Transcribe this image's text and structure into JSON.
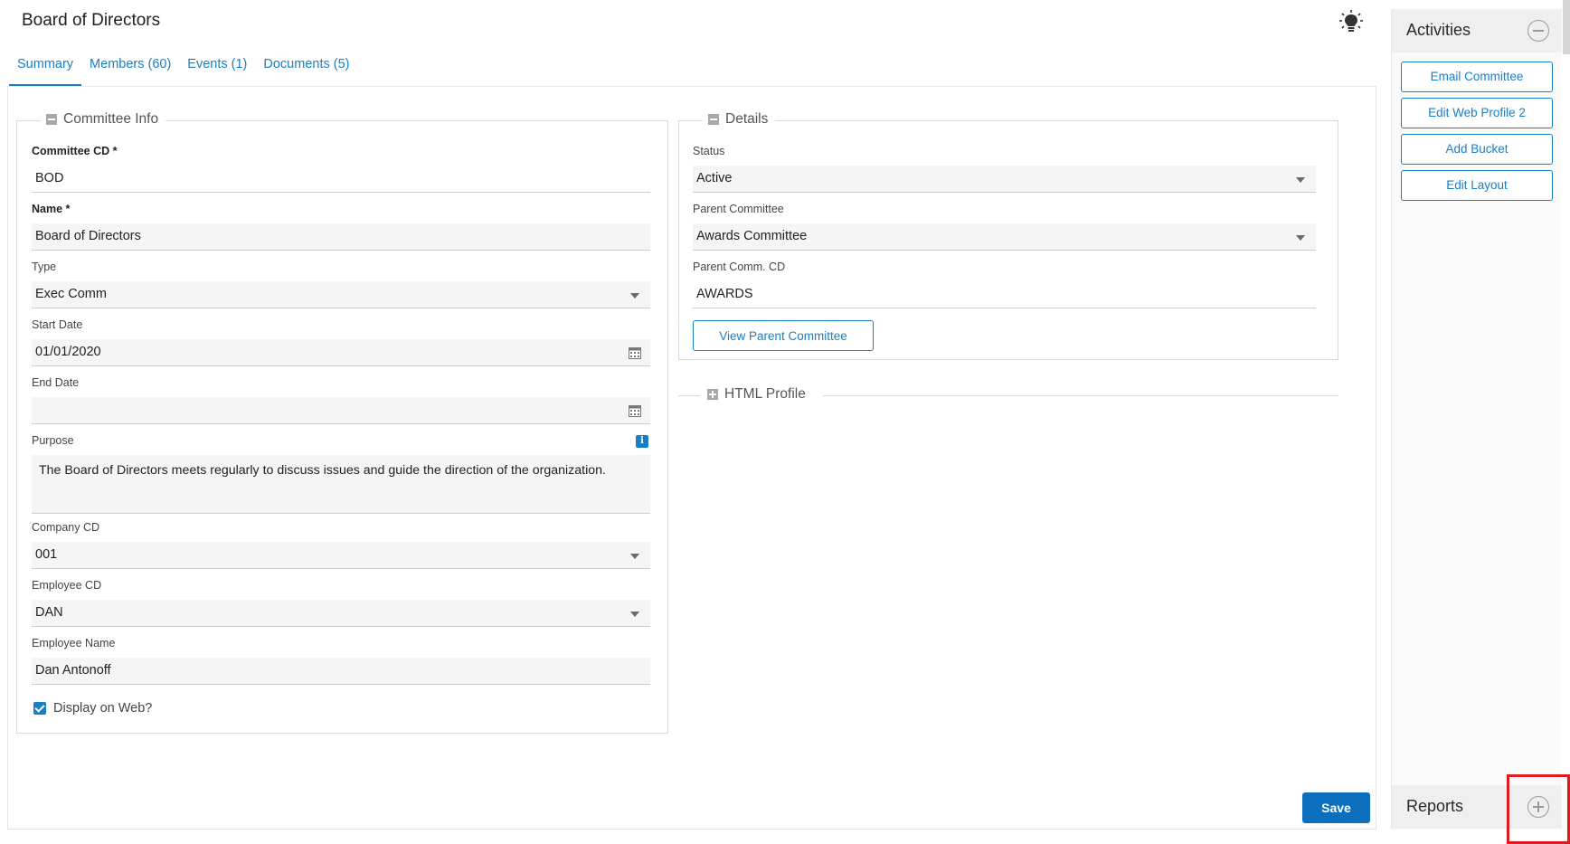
{
  "page": {
    "title": "Board of Directors"
  },
  "tabs": [
    {
      "label": "Summary",
      "active": true
    },
    {
      "label": "Members (60)",
      "active": false
    },
    {
      "label": "Events (1)",
      "active": false
    },
    {
      "label": "Documents (5)",
      "active": false
    }
  ],
  "committee_info": {
    "legend": "Committee Info",
    "committee_cd": {
      "label": "Committee CD *",
      "value": "BOD"
    },
    "name": {
      "label": "Name *",
      "value": "Board of Directors"
    },
    "type": {
      "label": "Type",
      "value": "Exec Comm"
    },
    "start_date": {
      "label": "Start Date",
      "value": "01/01/2020"
    },
    "end_date": {
      "label": "End Date",
      "value": ""
    },
    "purpose": {
      "label": "Purpose",
      "value": "The Board of Directors meets regularly to discuss issues and guide the direction of the organization."
    },
    "company_cd": {
      "label": "Company CD",
      "value": "001"
    },
    "employee_cd": {
      "label": "Employee CD",
      "value": "DAN"
    },
    "employee_name": {
      "label": "Employee Name",
      "value": "Dan Antonoff"
    },
    "display_on_web": {
      "label": "Display on Web?",
      "checked": true
    }
  },
  "details": {
    "legend": "Details",
    "status": {
      "label": "Status",
      "value": "Active"
    },
    "parent_committee": {
      "label": "Parent Committee",
      "value": "Awards Committee"
    },
    "parent_comm_cd": {
      "label": "Parent Comm. CD",
      "value": "AWARDS"
    },
    "view_parent_button": "View Parent Committee"
  },
  "html_profile": {
    "legend": "HTML Profile"
  },
  "save_button": "Save",
  "activities": {
    "title": "Activities",
    "buttons": [
      "Email Committee",
      "Edit Web Profile 2",
      "Add Bucket",
      "Edit Layout"
    ]
  },
  "reports": {
    "title": "Reports"
  },
  "colors": {
    "accent": "#1a7fc1",
    "save": "#0c6fbd",
    "highlight": "#e01b1b"
  },
  "icons": [
    "lightbulb-icon",
    "calendar-icon",
    "info-icon",
    "collapse-icon",
    "expand-icon",
    "checkbox-checked-icon",
    "minus-circle-icon",
    "plus-circle-icon",
    "caret-down-icon"
  ]
}
